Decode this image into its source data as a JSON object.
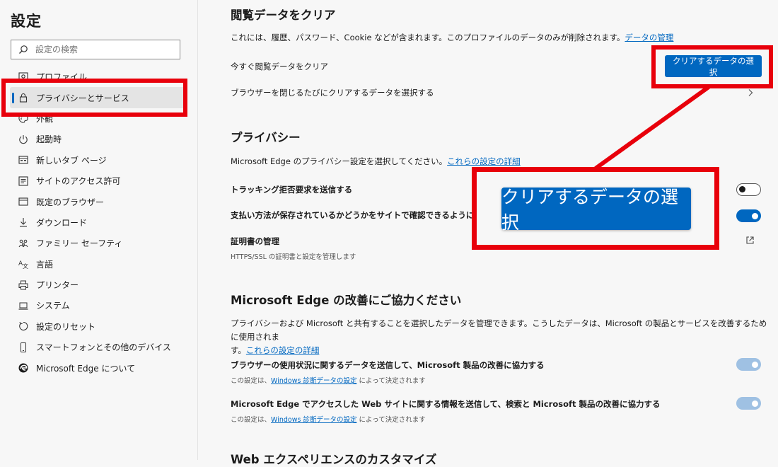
{
  "sidebar": {
    "title": "設定",
    "search_placeholder": "設定の検索",
    "items": [
      {
        "label": "プロファイル",
        "icon": "profile-icon"
      },
      {
        "label": "プライバシーとサービス",
        "icon": "lock-icon",
        "active": true
      },
      {
        "label": "外観",
        "icon": "palette-icon"
      },
      {
        "label": "起動時",
        "icon": "power-icon"
      },
      {
        "label": "新しいタブ ページ",
        "icon": "new-tab-icon"
      },
      {
        "label": "サイトのアクセス許可",
        "icon": "site-permissions-icon"
      },
      {
        "label": "既定のブラウザー",
        "icon": "default-browser-icon"
      },
      {
        "label": "ダウンロード",
        "icon": "download-icon"
      },
      {
        "label": "ファミリー セーフティ",
        "icon": "family-icon"
      },
      {
        "label": "言語",
        "icon": "language-icon"
      },
      {
        "label": "プリンター",
        "icon": "printer-icon"
      },
      {
        "label": "システム",
        "icon": "laptop-icon"
      },
      {
        "label": "設定のリセット",
        "icon": "reset-icon"
      },
      {
        "label": "スマートフォンとその他のデバイス",
        "icon": "phone-icon"
      },
      {
        "label": "Microsoft Edge について",
        "icon": "edge-logo-icon"
      }
    ]
  },
  "clear_data": {
    "title": "閲覧データをクリア",
    "desc": "これには、履歴、パスワード、Cookie などが含まれます。このプロファイルのデータのみが削除されます。",
    "desc_link": "データの管理",
    "clear_now_label": "今すぐ閲覧データをクリア",
    "clear_button": "クリアするデータの選択",
    "on_close_label": "ブラウザーを閉じるたびにクリアするデータを選択する"
  },
  "privacy": {
    "title": "プライバシー",
    "desc": "Microsoft Edge のプライバシー設定を選択してください。",
    "desc_link": "これらの設定の詳細",
    "dnt_label": "トラッキング拒否要求を送信する",
    "dnt_on": false,
    "payment_label": "支払い方法が保存されているかどうかをサイトで確認できるようにする",
    "payment_on": true,
    "cert_label": "証明書の管理",
    "cert_sub": "HTTPS/SSL の証明書と設定を管理します"
  },
  "improve": {
    "title": "Microsoft Edge の改善にご協力ください",
    "desc_line1": "プライバシーおよび Microsoft と共有することを選択したデータを管理できます。こうしたデータは、Microsoft の製品とサービスを改善するために使用されま",
    "desc_line2_prefix": "す。",
    "desc_link": "これらの設定の詳細",
    "usage_label": "ブラウザーの使用状況に関するデータを送信して、Microsoft 製品の改善に協力する",
    "usage_sub_prefix": "この設定は、",
    "usage_sub_link": "Windows 診断データの設定",
    "usage_sub_suffix": " によって決定されます",
    "sites_label": "Microsoft Edge でアクセスした Web サイトに関する情報を送信して、検索と Microsoft 製品の改善に協力する",
    "sites_sub_prefix": "この設定は、",
    "sites_sub_link": "Windows 診断データの設定",
    "sites_sub_suffix": " によって決定されます"
  },
  "web_experience": {
    "title": "Web エクスペリエンスのカスタマイズ"
  },
  "zoom_callout": {
    "button_label": "クリアするデータの選択"
  },
  "colors": {
    "accent": "#0067c0",
    "highlight": "#e8000b"
  }
}
